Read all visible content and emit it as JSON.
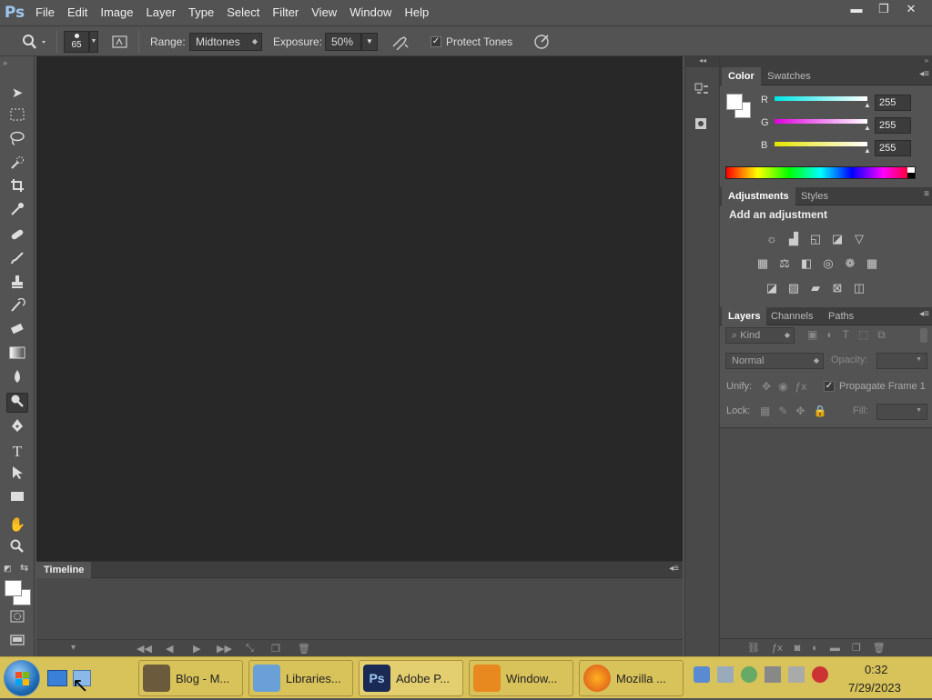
{
  "app": {
    "logo": "Ps"
  },
  "menu": [
    "File",
    "Edit",
    "Image",
    "Layer",
    "Type",
    "Select",
    "Filter",
    "View",
    "Window",
    "Help"
  ],
  "window_controls": {
    "minimize": "▬",
    "restore": "❐",
    "close": "✕"
  },
  "options": {
    "brush_size": "65",
    "range_label": "Range:",
    "range_value": "Midtones",
    "exposure_label": "Exposure:",
    "exposure_value": "50%",
    "protect_tones": "Protect Tones",
    "protect_tones_checked": true
  },
  "color_panel": {
    "tabs": [
      "Color",
      "Swatches"
    ],
    "channels": [
      {
        "label": "R",
        "value": "255",
        "color": "#00e5e5"
      },
      {
        "label": "G",
        "value": "255",
        "color": "#e000e0"
      },
      {
        "label": "B",
        "value": "255",
        "color": "#e5e500"
      }
    ]
  },
  "adjustments_panel": {
    "tabs": [
      "Adjustments",
      "Styles"
    ],
    "heading": "Add an adjustment"
  },
  "layers_panel": {
    "tabs": [
      "Layers",
      "Channels",
      "Paths"
    ],
    "filter_kind": "Kind",
    "blend_mode": "Normal",
    "opacity_label": "Opacity:",
    "unify_label": "Unify:",
    "propagate_label": "Propagate Frame 1",
    "lock_label": "Lock:",
    "fill_label": "Fill:"
  },
  "timeline": {
    "tab": "Timeline"
  },
  "taskbar": {
    "items": [
      "Blog - M...",
      "Libraries...",
      "Adobe P...",
      "Window...",
      "Mozilla ..."
    ],
    "clock_time": "0:32",
    "clock_date": "7/29/2023"
  }
}
